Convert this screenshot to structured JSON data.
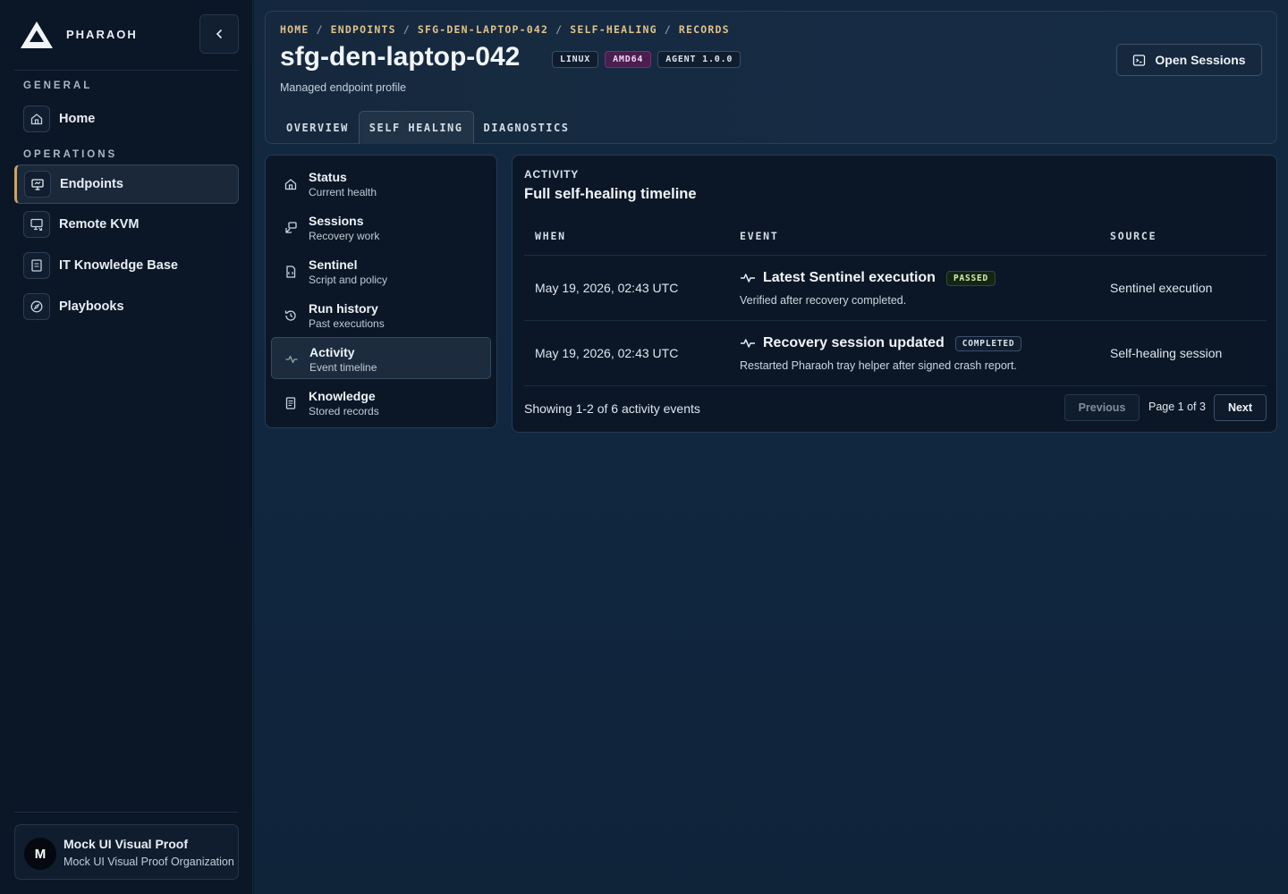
{
  "brand": {
    "name": "PHARAOH"
  },
  "sidebar": {
    "sections": [
      {
        "label": "GENERAL"
      },
      {
        "label": "OPERATIONS"
      }
    ],
    "items": [
      {
        "label": "Home",
        "icon": "home-icon"
      },
      {
        "label": "Endpoints",
        "icon": "monitor-icon",
        "active": true
      },
      {
        "label": "Remote KVM",
        "icon": "remote-screen-icon"
      },
      {
        "label": "IT Knowledge Base",
        "icon": "book-icon"
      },
      {
        "label": "Playbooks",
        "icon": "compass-icon"
      }
    ],
    "org": {
      "initial": "M",
      "name": "Mock UI Visual Proof",
      "subtitle": "Mock UI Visual Proof Organization"
    }
  },
  "header": {
    "breadcrumb": [
      "HOME",
      "ENDPOINTS",
      "SFG-DEN-LAPTOP-042",
      "SELF-HEALING",
      "RECORDS"
    ],
    "title": "sfg-den-laptop-042",
    "badges": [
      "LINUX",
      "AMD64",
      "AGENT 1.0.0"
    ],
    "subtitle": "Managed endpoint profile",
    "open_sessions_label": "Open Sessions",
    "tabs": [
      "OVERVIEW",
      "SELF HEALING",
      "DIAGNOSTICS"
    ],
    "active_tab": "SELF HEALING"
  },
  "subnav": {
    "items": [
      {
        "title": "Status",
        "desc": "Current health",
        "icon": "home-icon"
      },
      {
        "title": "Sessions",
        "desc": "Recovery work",
        "icon": "sessions-icon"
      },
      {
        "title": "Sentinel",
        "desc": "Script and policy",
        "icon": "script-file-icon"
      },
      {
        "title": "Run history",
        "desc": "Past executions",
        "icon": "history-icon"
      },
      {
        "title": "Activity",
        "desc": "Event timeline",
        "icon": "activity-icon",
        "active": true
      },
      {
        "title": "Knowledge",
        "desc": "Stored records",
        "icon": "document-icon"
      }
    ]
  },
  "activity": {
    "kicker": "ACTIVITY",
    "title": "Full self-healing timeline",
    "columns": [
      "WHEN",
      "EVENT",
      "SOURCE"
    ],
    "rows": [
      {
        "when": "May 19, 2026, 02:43 UTC",
        "event": "Latest Sentinel execution",
        "status": "PASSED",
        "desc": "Verified after recovery completed.",
        "source": "Sentinel execution"
      },
      {
        "when": "May 19, 2026, 02:43 UTC",
        "event": "Recovery session updated",
        "status": "COMPLETED",
        "desc": "Restarted Pharaoh tray helper after signed crash report.",
        "source": "Self-healing session"
      }
    ],
    "footer": "Showing 1-2 of 6 activity events",
    "previous_label": "Previous",
    "page_indicator": "Page 1 of 3",
    "next_label": "Next"
  },
  "colors": {
    "accent_gold": "#e0c28a",
    "active_border": "#c9a56a",
    "amd64_badge": "#4a1f4f",
    "passed_text": "#d8f0a8"
  }
}
